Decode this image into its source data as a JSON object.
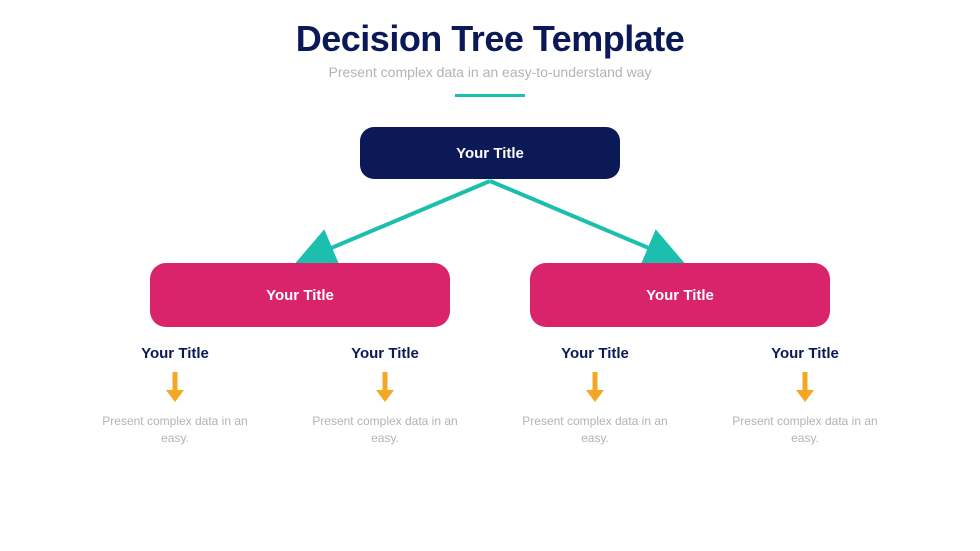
{
  "header": {
    "title": "Decision Tree Template",
    "subtitle": "Present complex data in an easy-to-understand way"
  },
  "root": {
    "label": "Your Title"
  },
  "branches": [
    {
      "label": "Your Title"
    },
    {
      "label": "Your Title"
    }
  ],
  "leaves": [
    {
      "title": "Your Title",
      "desc": "Present complex data in an easy."
    },
    {
      "title": "Your Title",
      "desc": "Present complex data in an easy."
    },
    {
      "title": "Your Title",
      "desc": "Present complex data in an easy."
    },
    {
      "title": "Your Title",
      "desc": "Present complex data in an easy."
    }
  ],
  "colors": {
    "navy": "#0b1957",
    "teal": "#1cbfae",
    "magenta": "#d9236a",
    "orange": "#f5a623",
    "gray": "#b3b3b3"
  }
}
